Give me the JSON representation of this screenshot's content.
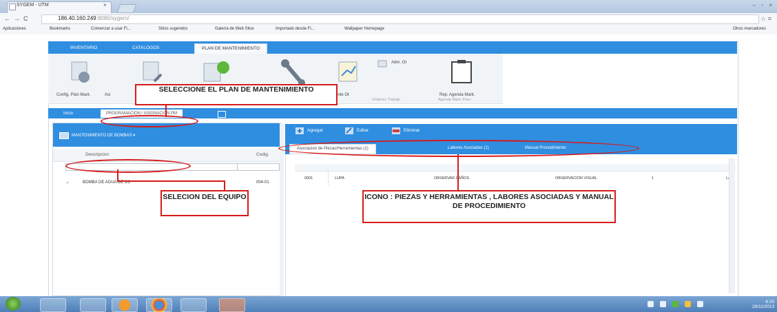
{
  "browser": {
    "tab_title": "SYGEM - UTM",
    "tab_close": "×",
    "window_controls": "– ▫ ×",
    "url_host": "186.40.160.249",
    "url_path": ":8080/sygem/",
    "bookmarks": [
      "Aplicaciones",
      "Bookmarks",
      "Comenzar a usar Fi...",
      "Sitios sugeridos",
      "Galería de Web Slice",
      "Importado desde Fi...",
      "Wallpaper Homepage"
    ],
    "other_bookmarks": "Otros marcadores"
  },
  "app": {
    "nav": [
      "INVENTARIO",
      "CATALOGOS",
      "PLAN DE MANTENIMIENTO"
    ],
    "ribbon": {
      "buttons": [
        "Config. Plan Mant.",
        "Asi",
        "",
        "Asistente Ot",
        "Adm. Ot",
        "Rep. Agenda Mant."
      ],
      "groups": [
        "Ordenes Trabajo",
        "Agenda Mant. Prev."
      ]
    },
    "subtabs": [
      "Inicio",
      "PROGRAMACION / ASIGNACION PM"
    ],
    "left_panel": {
      "title": "MANTENIMIENTO DE BOMBAS",
      "col_description": "Descripcion",
      "col_code": "Codig",
      "row": {
        "check": "✓",
        "description": "BOMBA DE AGUA DE 1/2",
        "code": "004-01"
      }
    },
    "right_panel": {
      "tools": [
        "Agregar",
        "Editar",
        "Eliminar"
      ],
      "tabs": [
        "Asociacion de Piezas/Herramientas (1)",
        "Labores Asociadas (1)",
        "Manual Procedimiento"
      ],
      "row": [
        "0001",
        "LUPA",
        "OBSERVAR DAÑOS",
        "OBSERVACIÓN VISUAL",
        "1",
        "LA"
      ]
    }
  },
  "annotations": {
    "plan": "SELECCIONE EL PLAN DE MANTENIMIENTO",
    "equipo": "SELECION DEL EQUIPO",
    "icono": "ICONO : PIEZAS Y HERRAMIENTAS , LABORES ASOCIADAS Y MANUAL DE PROCEDIMIENTO"
  },
  "taskbar": {
    "time": "8:25",
    "date": "28/11/2013"
  }
}
